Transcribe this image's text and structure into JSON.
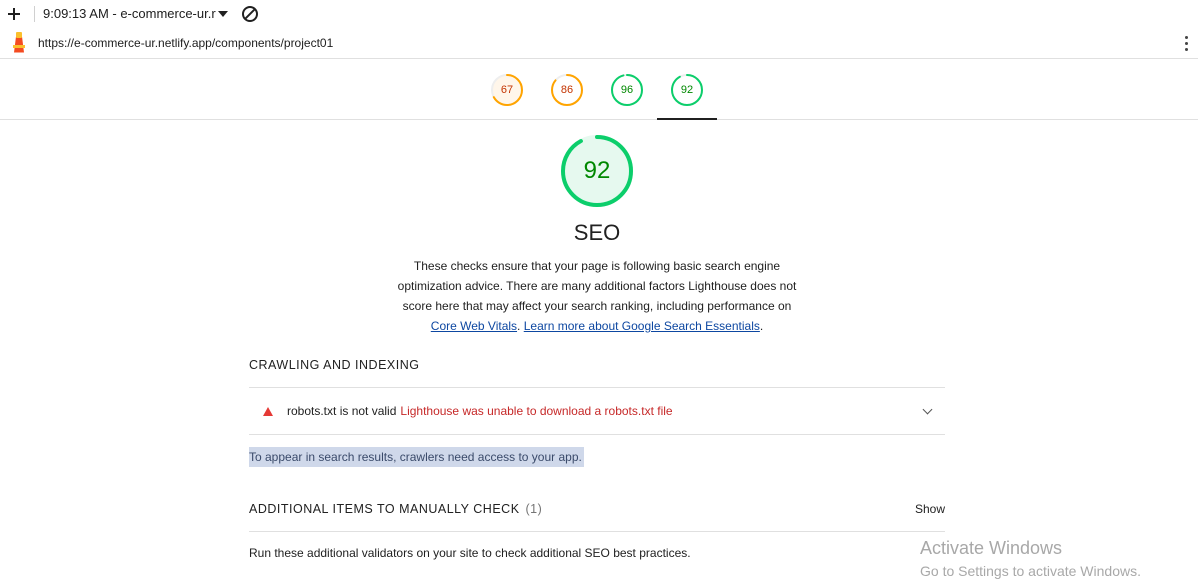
{
  "topbar": {
    "session_label": "9:09:13 AM - e-commerce-ur.r"
  },
  "urlbar": {
    "url": "https://e-commerce-ur.netlify.app/components/project01"
  },
  "gauges": [
    {
      "score": "67",
      "color": "#ffa400",
      "fill": "#fff6ea",
      "text_color": "#c33300",
      "fraction": 0.67
    },
    {
      "score": "86",
      "color": "#ffa400",
      "fill": "#ffffff",
      "text_color": "#c33300",
      "fraction": 0.86
    },
    {
      "score": "96",
      "color": "#0cce6b",
      "fill": "#ffffff",
      "text_color": "#008800",
      "fraction": 0.96
    },
    {
      "score": "92",
      "color": "#0cce6b",
      "fill": "#ffffff",
      "text_color": "#008800",
      "fraction": 0.92
    }
  ],
  "category": {
    "score": "92",
    "title": "SEO",
    "description_text": "These checks ensure that your page is following basic search engine optimization advice. There are many additional factors Lighthouse does not score here that may affect your search ranking, including performance on",
    "link_cwv": "Core Web Vitals",
    "link_sep": ".",
    "link_learn": "Learn more about Google Search Essentials",
    "link_end": "."
  },
  "crawling": {
    "title": "CRAWLING AND INDEXING",
    "audit_title": "robots.txt is not valid",
    "audit_error": "Lighthouse was unable to download a robots.txt file",
    "hint": "To appear in search results, crawlers need access to your app."
  },
  "manual": {
    "title": "ADDITIONAL ITEMS TO MANUALLY CHECK",
    "count": "(1)",
    "show_label": "Show",
    "description": "Run these additional validators on your site to check additional SEO best practices."
  },
  "watermark": {
    "line1": "Activate Windows",
    "line2": "Go to Settings to activate Windows."
  },
  "colors": {
    "pass": "#0cce6b",
    "average": "#ffa400",
    "fail": "#e53935"
  }
}
